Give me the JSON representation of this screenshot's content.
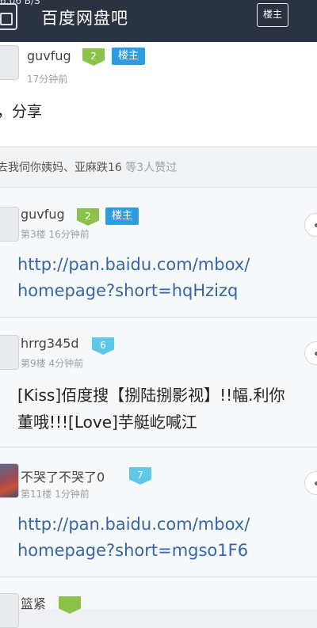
{
  "status_bar": {
    "text": "6:06 B/S"
  },
  "header": {
    "title": "百度网盘吧",
    "right_button": "楼主"
  },
  "main_post": {
    "username": "guvfug",
    "level": "2",
    "lz_badge": "楼主",
    "time": "17分钟前",
    "content": "，分享"
  },
  "likes": {
    "names": "去我伺你姨妈、亚麻跌16",
    "count_text": "等3人赞过"
  },
  "replies": [
    {
      "username": "guvfug",
      "level": "2",
      "lz_badge": "楼主",
      "floor": "第3楼",
      "time": "16分钟前",
      "content_line1": "http://pan.baidu.com/mbox/",
      "content_line2": "homepage?short=hqHzizq"
    },
    {
      "username": "hrrg345d",
      "level": "6",
      "floor": "第9楼",
      "time": "4分钟前",
      "content_line1": "[Kiss]佰度搜【捌陆捌影视】!!幅.利你",
      "content_line2": "董哦!!![Love]芋艇屹喊江"
    },
    {
      "username": "不哭了不哭了0",
      "level": "7",
      "floor": "第11楼",
      "time": "1分钟前",
      "content_line1": "http://pan.baidu.com/mbox/",
      "content_line2": "homepage?short=mgso1F6"
    },
    {
      "username": "篮紧"
    }
  ]
}
